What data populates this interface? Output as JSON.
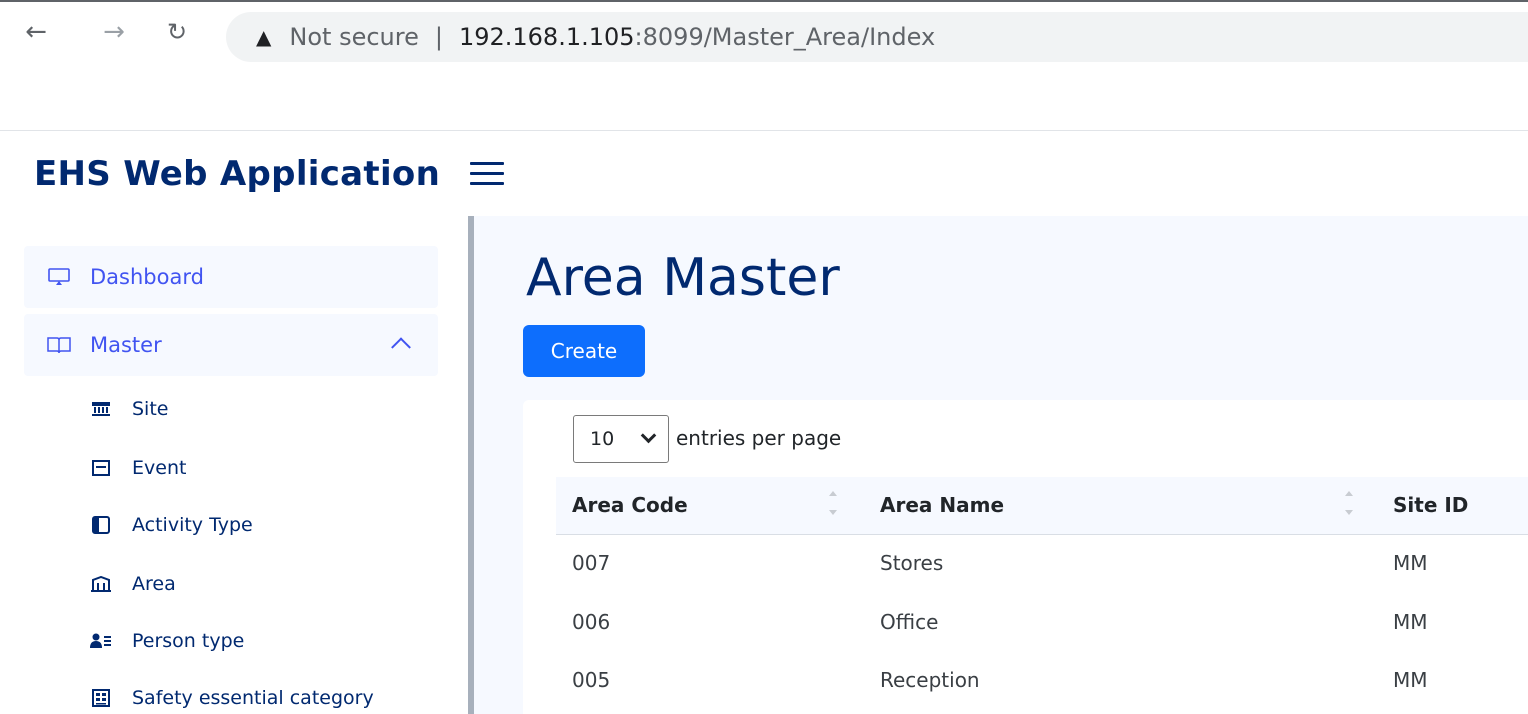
{
  "browser": {
    "security_text": "Not secure",
    "url_host": "192.168.1.105",
    "url_path": ":8099/Master_Area/Index"
  },
  "header": {
    "brand": "EHS Web Application"
  },
  "sidebar": {
    "dashboard": "Dashboard",
    "master": "Master",
    "sub_items": [
      {
        "label": "Site",
        "icon": "bank-icon"
      },
      {
        "label": "Event",
        "icon": "card-icon"
      },
      {
        "label": "Activity Type",
        "icon": "layout-icon"
      },
      {
        "label": "Area",
        "icon": "area-icon"
      },
      {
        "label": "Person type",
        "icon": "person-list-icon"
      },
      {
        "label": "Safety essential category",
        "icon": "grid-icon"
      }
    ]
  },
  "main": {
    "title": "Area Master",
    "create_label": "Create",
    "page_size": "10",
    "entries_label": "entries per page",
    "columns": [
      "Area Code",
      "Area Name",
      "Site ID"
    ],
    "rows": [
      [
        "007",
        "Stores",
        "MM"
      ],
      [
        "006",
        "Office",
        "MM"
      ],
      [
        "005",
        "Reception",
        "MM"
      ]
    ]
  }
}
